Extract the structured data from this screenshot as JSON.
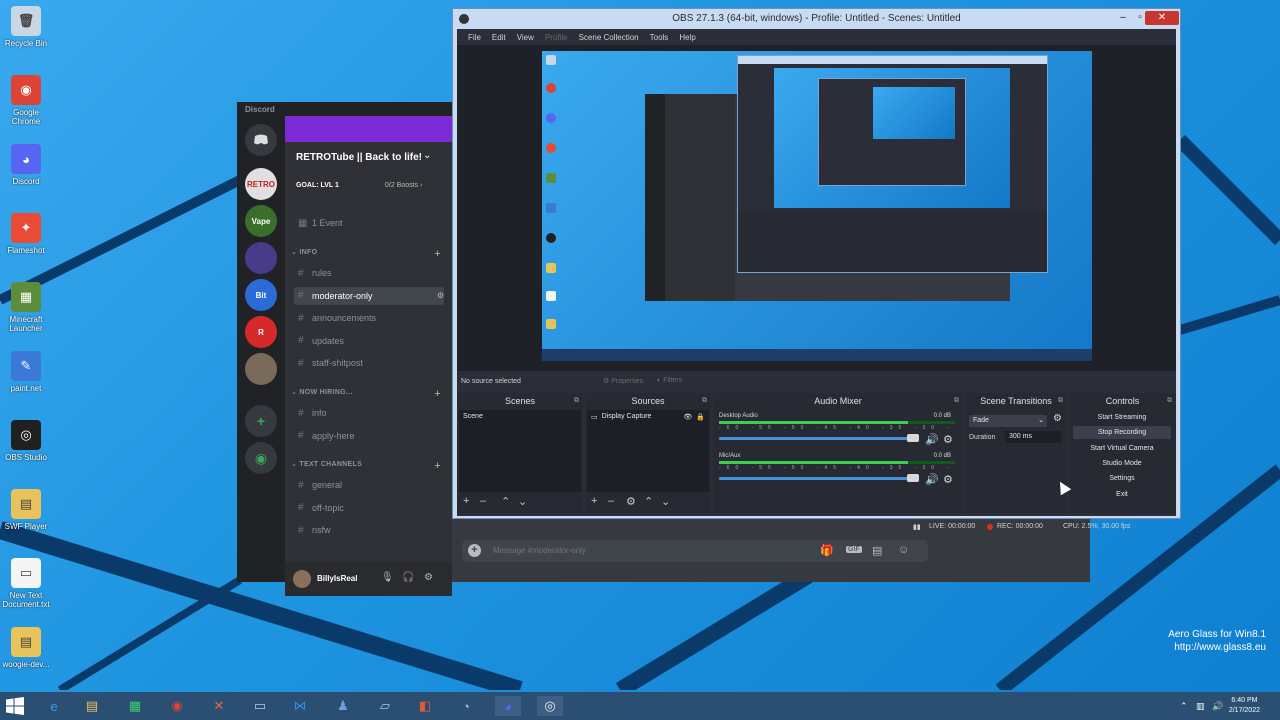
{
  "desktop": {
    "icons": [
      {
        "label": "Recycle Bin",
        "color": "#c9d6e3",
        "glyph": "🗑"
      },
      {
        "label": "Google Chrome",
        "color": "#db4437",
        "glyph": "◉"
      },
      {
        "label": "Discord",
        "color": "#5865f2",
        "glyph": "◕"
      },
      {
        "label": "Flameshot",
        "color": "#e94b35",
        "glyph": "✦"
      },
      {
        "label": "Minecraft Launcher",
        "color": "#5d8c3a",
        "glyph": "▦"
      },
      {
        "label": "paint.net",
        "color": "#3c78d8",
        "glyph": "✎"
      },
      {
        "label": "OBS Studio",
        "color": "#202020",
        "glyph": "◎"
      },
      {
        "label": "SWF Player",
        "color": "#e8c25a",
        "glyph": "▤"
      },
      {
        "label": "New Text Document.txt",
        "color": "#f5f5f5",
        "glyph": "▭"
      },
      {
        "label": "woogie-dev...",
        "color": "#e8c25a",
        "glyph": "▤"
      }
    ],
    "watermark_line1": "Aero Glass for Win8.1",
    "watermark_line2": "http://www.glass8.eu"
  },
  "discord": {
    "titlebar": "Discord",
    "server_name": "RETROTube || Back to life!",
    "goal": "GOAL: LVL 1",
    "boosts": "0/2 Boosts",
    "events": "1 Event",
    "categories": {
      "info": "INFO",
      "hiring": "NOW HIRING...",
      "text": "TEXT CHANNELS"
    },
    "channels_info": [
      "rules",
      "moderator-only",
      "announcements",
      "updates",
      "staff-shitpost"
    ],
    "channels_hiring": [
      "info",
      "apply-here"
    ],
    "channels_text": [
      "general",
      "off-topic",
      "nsfw"
    ],
    "username": "BillyIsReal",
    "message_placeholder": "Message #moderator-only",
    "guilds": [
      {
        "label": "RETRO",
        "color": "#e0e0e0",
        "text_color": "#c81e1e"
      },
      {
        "label": "Vape",
        "color": "#3a6e2a",
        "text_color": "#ffffff"
      },
      {
        "label": "",
        "color": "#4a3a8a",
        "text_color": "#ffffff"
      },
      {
        "label": "Bit",
        "color": "#2a6bd6",
        "text_color": "#ffffff"
      },
      {
        "label": "R",
        "color": "#d62a2a",
        "text_color": "#ffffff"
      },
      {
        "label": "",
        "color": "#7a6a5a",
        "text_color": "#ffffff"
      }
    ]
  },
  "obs": {
    "title": "OBS 27.1.3 (64-bit, windows) - Profile: Untitled - Scenes: Untitled",
    "menu": [
      "File",
      "Edit",
      "View",
      "Profile",
      "Scene Collection",
      "Tools",
      "Help"
    ],
    "no_source": "No source selected",
    "properties_btn": "Properties",
    "filters_btn": "Filters",
    "docks": {
      "scenes": "Scenes",
      "sources": "Sources",
      "mixer": "Audio Mixer",
      "transitions": "Scene Transitions",
      "controls": "Controls"
    },
    "scene_item": "Scene",
    "source_item": "Display Capture",
    "mixer": {
      "desktop_name": "Desktop Audio",
      "desktop_db": "0.0 dB",
      "mic_name": "Mic/Aux",
      "mic_db": "0.0 dB",
      "scale": "-60 -55 -50 -45 -40 -35 -30 -25 -20 -15 -10 -5 0"
    },
    "transitions": {
      "type": "Fade",
      "duration_label": "Duration",
      "duration_value": "300 ms"
    },
    "controls": [
      "Start Streaming",
      "Stop Recording",
      "Start Virtual Camera",
      "Studio Mode",
      "Settings",
      "Exit"
    ],
    "status": {
      "live": "LIVE: 00:00:00",
      "rec": "REC: 00:00:00",
      "cpu": "CPU: 2.5%, 30.00 fps"
    }
  },
  "taskbar": {
    "clock_time": "6:40 PM",
    "clock_date": "2/17/2022"
  }
}
